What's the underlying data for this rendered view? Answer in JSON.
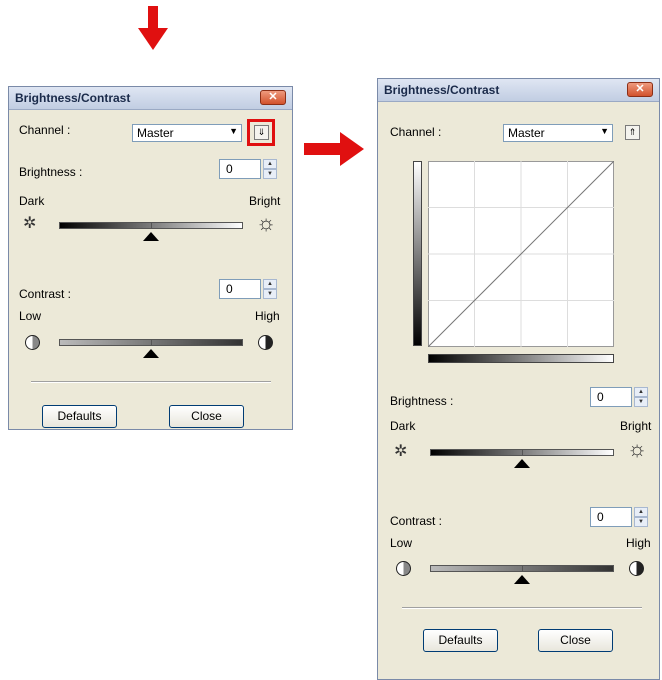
{
  "dialog_collapsed": {
    "title": "Brightness/Contrast",
    "close_glyph": "✕",
    "channel_label": "Channel :",
    "channel_value": "Master",
    "expand_button_glyph": "⇓",
    "brightness_label": "Brightness :",
    "brightness_value": "0",
    "dark_label": "Dark",
    "bright_label": "Bright",
    "contrast_label": "Contrast :",
    "contrast_value": "0",
    "low_label": "Low",
    "high_label": "High",
    "defaults_label": "Defaults",
    "close_label": "Close"
  },
  "dialog_expanded": {
    "title": "Brightness/Contrast",
    "close_glyph": "✕",
    "channel_label": "Channel :",
    "channel_value": "Master",
    "collapse_button_glyph": "⇑",
    "brightness_label": "Brightness :",
    "brightness_value": "0",
    "dark_label": "Dark",
    "bright_label": "Bright",
    "contrast_label": "Contrast :",
    "contrast_value": "0",
    "low_label": "Low",
    "high_label": "High",
    "defaults_label": "Defaults",
    "close_label": "Close"
  },
  "brightness_level": 0,
  "contrast_level": 0,
  "annotation_color": "#e01010"
}
